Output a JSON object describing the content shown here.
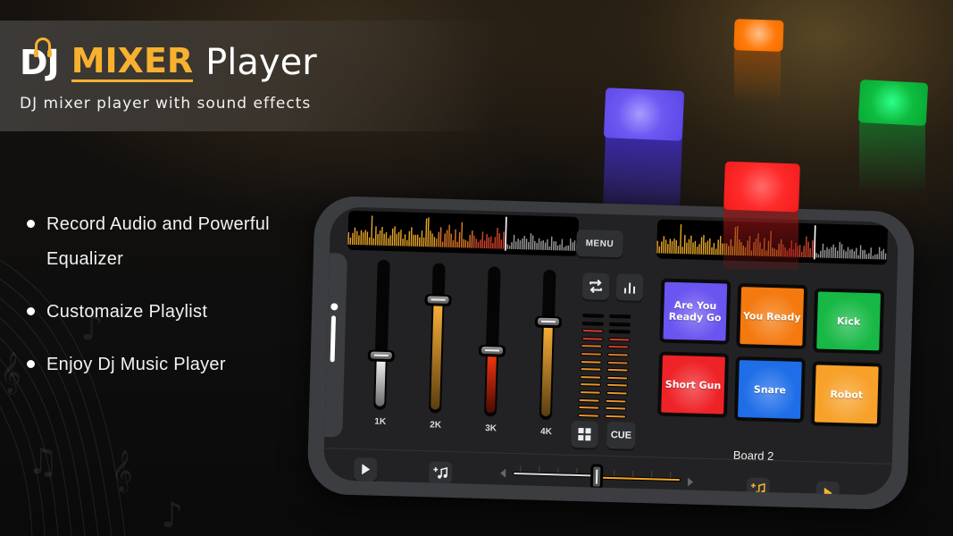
{
  "header": {
    "brand_dj": "DJ",
    "brand_mixer": "MIXER",
    "brand_player": "Player",
    "subtitle": "DJ mixer player with sound effects"
  },
  "features": [
    {
      "line1": "Record  Audio and Powerful",
      "line2": "Equalizer"
    },
    {
      "line1": "Customaize Playlist",
      "line2": ""
    },
    {
      "line1": "Enjoy Dj Music Player",
      "line2": ""
    }
  ],
  "colors": {
    "accent": "#f7b12f",
    "pad_purple": "#6a55f0",
    "pad_orange": "#f47a10",
    "pad_green": "#17b845",
    "pad_red": "#ee2328",
    "pad_blue": "#1f6ee8",
    "pad_amber": "#f7a12a"
  },
  "app": {
    "menu_label": "MENU",
    "cue_label": "CUE",
    "icons": {
      "loop": "loop-icon",
      "equalizer": "equalizer-icon",
      "grid": "grid-icon",
      "play_left": "play-icon",
      "add_music_left": "add-music-icon",
      "add_music_right": "add-music-icon",
      "play_right": "play-icon"
    },
    "deck_left": {
      "progress": 0.68
    },
    "deck_right": {
      "progress": 0.68
    },
    "equalizer": [
      {
        "label": "1K",
        "level": 0.38,
        "color": "white"
      },
      {
        "label": "2K",
        "level": 0.84,
        "color": "amber"
      },
      {
        "label": "3K",
        "level": 0.47,
        "color": "red"
      },
      {
        "label": "4K",
        "level": 0.72,
        "color": "amber"
      }
    ],
    "vu_meter": {
      "left_lit": 12,
      "right_lit": 11,
      "total": 14
    },
    "pads": [
      {
        "label": "Are You Ready Go",
        "color": "#6a55f0"
      },
      {
        "label": "You Ready",
        "color": "#f47a10"
      },
      {
        "label": "Kick",
        "color": "#17b845"
      },
      {
        "label": "Short Gun",
        "color": "#ee2328"
      },
      {
        "label": "Snare",
        "color": "#1f6ee8"
      },
      {
        "label": "Robot",
        "color": "#f7a12a"
      }
    ],
    "board_label": "Board 2",
    "crossfader": {
      "position": 0.5
    }
  }
}
